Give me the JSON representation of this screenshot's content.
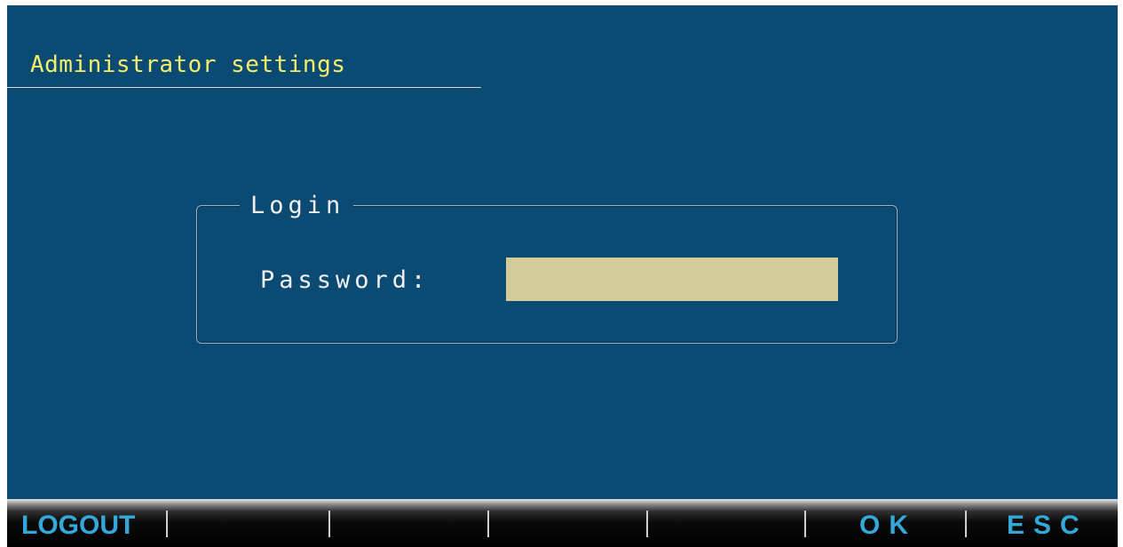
{
  "header": {
    "title": "Administrator settings"
  },
  "login": {
    "legend": "Login",
    "password_label": "Password:",
    "password_value": ""
  },
  "softkeys": {
    "f1": "LOGOUT",
    "f2": "",
    "f3": "",
    "f4": "",
    "f5": "",
    "f6": "OK",
    "f7": "ESC"
  },
  "colors": {
    "background": "#0b4a72",
    "title_text": "#f3ef6a",
    "input_fill": "#d2cc9a",
    "softkey_text": "#34a9d9",
    "softkey_bar": "#000000"
  }
}
